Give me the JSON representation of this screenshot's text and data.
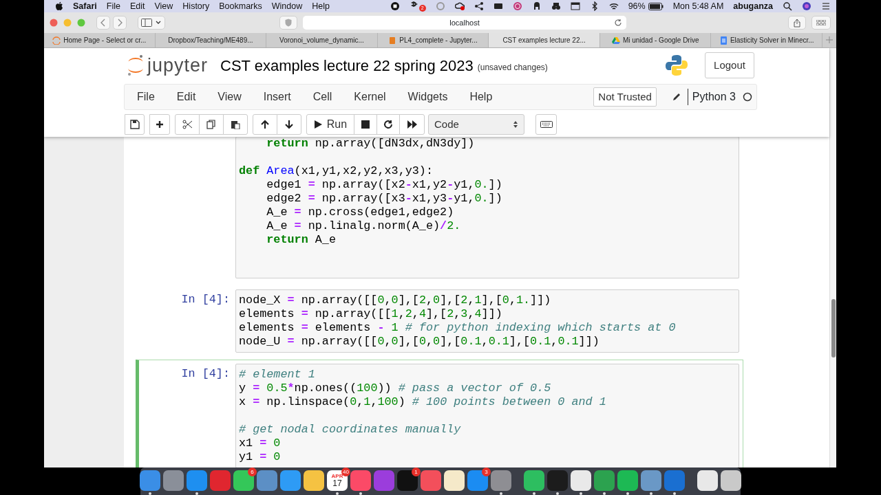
{
  "menu_bar": {
    "app": "Safari",
    "items": [
      "File",
      "Edit",
      "View",
      "History",
      "Bookmarks",
      "Window",
      "Help"
    ],
    "status_badge": "2",
    "battery": "96%",
    "clock": "Mon 5:48 AM",
    "user": "abuganza"
  },
  "browser": {
    "address": "localhost",
    "tabs": [
      {
        "label": "Home Page - Select or cr...",
        "kind": "jupyter",
        "selected": false
      },
      {
        "label": "Dropbox/Teaching/ME489...",
        "kind": "plain",
        "selected": false
      },
      {
        "label": "Voronoi_volume_dynamic...",
        "kind": "plain",
        "selected": false
      },
      {
        "label": "PL4_complete - Jupyter...",
        "kind": "book",
        "selected": false
      },
      {
        "label": "CST examples lecture 22...",
        "kind": "plain",
        "selected": true
      },
      {
        "label": "Mi unidad - Google Drive",
        "kind": "drive",
        "selected": false
      },
      {
        "label": "Elasticity Solver in Minecr...",
        "kind": "docs",
        "selected": false
      }
    ]
  },
  "notebook": {
    "logo_text": "jupyter",
    "title": "CST examples lecture 22 spring 2023",
    "save_status": "(unsaved changes)",
    "logout": "Logout",
    "menu": [
      "File",
      "Edit",
      "View",
      "Insert",
      "Cell",
      "Kernel",
      "Widgets",
      "Help"
    ],
    "trust": "Not Trusted",
    "kernel": "Python 3",
    "kernel_busy": false,
    "toolbar": {
      "run": "Run",
      "cell_type": "Code"
    },
    "cells": [
      {
        "selected": false,
        "lines": [
          {
            "kind": "code",
            "tokens": [
              {
                "kind": "kw",
                "text": "    return"
              },
              {
                "kind": "plain",
                "text": " np.array([dN3dx,dN3dy])"
              }
            ]
          },
          {
            "kind": "blank"
          },
          {
            "kind": "code",
            "tokens": [
              {
                "kind": "kw",
                "text": "def "
              },
              {
                "kind": "fn",
                "text": "Area"
              },
              {
                "kind": "plain",
                "text": "(x1,y1,x2,y2,x3,y3):"
              }
            ]
          },
          {
            "kind": "code",
            "tokens": [
              {
                "kind": "plain",
                "text": "    edge1 "
              },
              {
                "kind": "op",
                "text": "="
              },
              {
                "kind": "plain",
                "text": " np.array([x2"
              },
              {
                "kind": "op",
                "text": "-"
              },
              {
                "kind": "plain",
                "text": "x1,y2"
              },
              {
                "kind": "op",
                "text": "-"
              },
              {
                "kind": "plain",
                "text": "y1,"
              },
              {
                "kind": "num",
                "text": "0."
              },
              {
                "kind": "plain",
                "text": "])"
              }
            ]
          },
          {
            "kind": "code",
            "tokens": [
              {
                "kind": "plain",
                "text": "    edge2 "
              },
              {
                "kind": "op",
                "text": "="
              },
              {
                "kind": "plain",
                "text": " np.array([x3"
              },
              {
                "kind": "op",
                "text": "-"
              },
              {
                "kind": "plain",
                "text": "x1,y3"
              },
              {
                "kind": "op",
                "text": "-"
              },
              {
                "kind": "plain",
                "text": "y1,"
              },
              {
                "kind": "num",
                "text": "0."
              },
              {
                "kind": "plain",
                "text": "])"
              }
            ]
          },
          {
            "kind": "code",
            "tokens": [
              {
                "kind": "plain",
                "text": "    A_e "
              },
              {
                "kind": "op",
                "text": "="
              },
              {
                "kind": "plain",
                "text": " np.cross(edge1,edge2)"
              }
            ]
          },
          {
            "kind": "code",
            "tokens": [
              {
                "kind": "plain",
                "text": "    A_e "
              },
              {
                "kind": "op",
                "text": "="
              },
              {
                "kind": "plain",
                "text": " np.linalg.norm(A_e)"
              },
              {
                "kind": "op",
                "text": "/"
              },
              {
                "kind": "num",
                "text": "2."
              }
            ]
          },
          {
            "kind": "code",
            "tokens": [
              {
                "kind": "kw",
                "text": "    return"
              },
              {
                "kind": "plain",
                "text": " A_e"
              }
            ]
          },
          {
            "kind": "blank"
          },
          {
            "kind": "blank"
          }
        ]
      },
      {
        "selected": false,
        "prompt": "In [4]:",
        "lines": [
          {
            "kind": "code",
            "tokens": [
              {
                "kind": "plain",
                "text": "node_X "
              },
              {
                "kind": "op",
                "text": "="
              },
              {
                "kind": "plain",
                "text": " np.array([["
              },
              {
                "kind": "num",
                "text": "0"
              },
              {
                "kind": "plain",
                "text": ","
              },
              {
                "kind": "num",
                "text": "0"
              },
              {
                "kind": "plain",
                "text": "],["
              },
              {
                "kind": "num",
                "text": "2"
              },
              {
                "kind": "plain",
                "text": ","
              },
              {
                "kind": "num",
                "text": "0"
              },
              {
                "kind": "plain",
                "text": "],["
              },
              {
                "kind": "num",
                "text": "2"
              },
              {
                "kind": "plain",
                "text": ","
              },
              {
                "kind": "num",
                "text": "1"
              },
              {
                "kind": "plain",
                "text": "],["
              },
              {
                "kind": "num",
                "text": "0"
              },
              {
                "kind": "plain",
                "text": ","
              },
              {
                "kind": "num",
                "text": "1."
              },
              {
                "kind": "plain",
                "text": "]])"
              }
            ]
          },
          {
            "kind": "code",
            "tokens": [
              {
                "kind": "plain",
                "text": "elements "
              },
              {
                "kind": "op",
                "text": "="
              },
              {
                "kind": "plain",
                "text": " np.array([["
              },
              {
                "kind": "num",
                "text": "1"
              },
              {
                "kind": "plain",
                "text": ","
              },
              {
                "kind": "num",
                "text": "2"
              },
              {
                "kind": "plain",
                "text": ","
              },
              {
                "kind": "num",
                "text": "4"
              },
              {
                "kind": "plain",
                "text": "],["
              },
              {
                "kind": "num",
                "text": "2"
              },
              {
                "kind": "plain",
                "text": ","
              },
              {
                "kind": "num",
                "text": "3"
              },
              {
                "kind": "plain",
                "text": ","
              },
              {
                "kind": "num",
                "text": "4"
              },
              {
                "kind": "plain",
                "text": "]])"
              }
            ]
          },
          {
            "kind": "code",
            "tokens": [
              {
                "kind": "plain",
                "text": "elements "
              },
              {
                "kind": "op",
                "text": "="
              },
              {
                "kind": "plain",
                "text": " elements "
              },
              {
                "kind": "op",
                "text": "-"
              },
              {
                "kind": "num",
                "text": " 1 "
              },
              {
                "kind": "com",
                "text": "# for python indexing which starts at 0"
              }
            ]
          },
          {
            "kind": "code",
            "tokens": [
              {
                "kind": "plain",
                "text": "node_U "
              },
              {
                "kind": "op",
                "text": "="
              },
              {
                "kind": "plain",
                "text": " np.array([["
              },
              {
                "kind": "num",
                "text": "0"
              },
              {
                "kind": "plain",
                "text": ","
              },
              {
                "kind": "num",
                "text": "0"
              },
              {
                "kind": "plain",
                "text": "],["
              },
              {
                "kind": "num",
                "text": "0"
              },
              {
                "kind": "plain",
                "text": ","
              },
              {
                "kind": "num",
                "text": "0"
              },
              {
                "kind": "plain",
                "text": "],["
              },
              {
                "kind": "num",
                "text": "0.1"
              },
              {
                "kind": "plain",
                "text": ","
              },
              {
                "kind": "num",
                "text": "0.1"
              },
              {
                "kind": "plain",
                "text": "],["
              },
              {
                "kind": "num",
                "text": "0.1"
              },
              {
                "kind": "plain",
                "text": ","
              },
              {
                "kind": "num",
                "text": "0.1"
              },
              {
                "kind": "plain",
                "text": "]])"
              }
            ]
          }
        ]
      },
      {
        "selected": true,
        "prompt": "In [4]:",
        "lines": [
          {
            "kind": "code",
            "tokens": [
              {
                "kind": "com",
                "text": "# element 1"
              }
            ]
          },
          {
            "kind": "code",
            "tokens": [
              {
                "kind": "plain",
                "text": "y "
              },
              {
                "kind": "op",
                "text": "="
              },
              {
                "kind": "num",
                "text": " 0.5"
              },
              {
                "kind": "op",
                "text": "*"
              },
              {
                "kind": "plain",
                "text": "np.ones(("
              },
              {
                "kind": "num",
                "text": "100"
              },
              {
                "kind": "plain",
                "text": ")) "
              },
              {
                "kind": "com",
                "text": "# pass a vector of 0.5"
              }
            ]
          },
          {
            "kind": "code",
            "tokens": [
              {
                "kind": "plain",
                "text": "x "
              },
              {
                "kind": "op",
                "text": "="
              },
              {
                "kind": "plain",
                "text": " np.linspace("
              },
              {
                "kind": "num",
                "text": "0"
              },
              {
                "kind": "plain",
                "text": ","
              },
              {
                "kind": "num",
                "text": "1"
              },
              {
                "kind": "plain",
                "text": ","
              },
              {
                "kind": "num",
                "text": "100"
              },
              {
                "kind": "plain",
                "text": ") "
              },
              {
                "kind": "com",
                "text": "# 100 points between 0 and 1"
              }
            ]
          },
          {
            "kind": "blank"
          },
          {
            "kind": "code",
            "tokens": [
              {
                "kind": "com",
                "text": "# get nodal coordinates manually"
              }
            ]
          },
          {
            "kind": "code",
            "tokens": [
              {
                "kind": "plain",
                "text": "x1 "
              },
              {
                "kind": "op",
                "text": "="
              },
              {
                "kind": "num",
                "text": " 0"
              }
            ]
          },
          {
            "kind": "code",
            "tokens": [
              {
                "kind": "plain",
                "text": "y1 "
              },
              {
                "kind": "op",
                "text": "="
              },
              {
                "kind": "num",
                "text": " 0"
              }
            ]
          }
        ]
      }
    ]
  },
  "dock": {
    "groups": [
      [
        {
          "color": "#3a8ee6",
          "running": true
        },
        {
          "color": "#8a8f99",
          "running": false
        },
        {
          "color": "#1e8ff0",
          "running": true
        },
        {
          "color": "#e0262f",
          "running": false
        },
        {
          "color": "#34c759",
          "running": false,
          "badge": "6"
        },
        {
          "color": "#5c8fc5",
          "running": false
        },
        {
          "color": "#2e9bf5",
          "running": false
        },
        {
          "color": "#f5c242",
          "running": false
        },
        {
          "color": "#ffffff",
          "running": true,
          "month": "APR",
          "day": "17",
          "badge": "40"
        },
        {
          "color": "#fb4a67",
          "running": true
        },
        {
          "color": "#9b3ddc",
          "running": false
        },
        {
          "color": "#111111",
          "running": false,
          "badge": "1"
        },
        {
          "color": "#f34f5b",
          "running": false
        },
        {
          "color": "#f5e9c9",
          "running": false
        },
        {
          "color": "#1b8cf2",
          "running": false,
          "badge": "3"
        },
        {
          "color": "#8e8e93",
          "running": true
        }
      ],
      [
        {
          "color": "#2dbe60",
          "running": true
        },
        {
          "color": "#1c1c1c",
          "running": true
        },
        {
          "color": "#e9e9e9",
          "running": true
        },
        {
          "color": "#2ca24f",
          "running": true
        },
        {
          "color": "#1db954",
          "running": true
        },
        {
          "color": "#6a98c6",
          "running": true
        },
        {
          "color": "#1a6fd1",
          "running": true
        }
      ],
      [
        {
          "color": "#e8e8e8",
          "running": false
        },
        {
          "color": "#c9c9c9",
          "running": false
        }
      ]
    ]
  }
}
